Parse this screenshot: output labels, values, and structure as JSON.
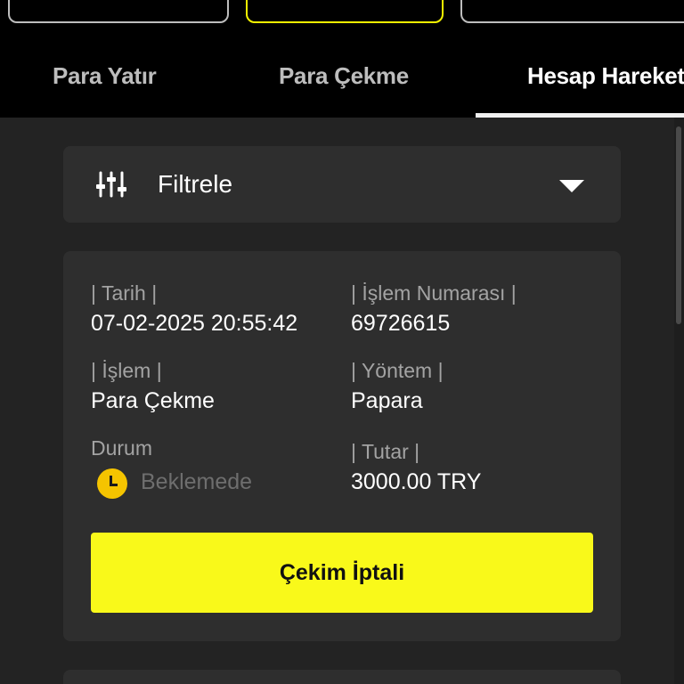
{
  "tabs": {
    "deposit": "Para Yatır",
    "withdraw": "Para Çekme",
    "history": "Hesap Hareketleri"
  },
  "filter": {
    "label": "Filtrele",
    "icon": "sliders-icon",
    "chevron": "chevron-down-icon"
  },
  "transaction": {
    "date_label": "| Tarih |",
    "date_value": "07-02-2025 20:55:42",
    "number_label": "| İşlem Numarası |",
    "number_value": "69726615",
    "type_label": "| İşlem |",
    "type_value": "Para Çekme",
    "method_label": "| Yöntem |",
    "method_value": "Papara",
    "status_label": "Durum",
    "status_value": "Beklemede",
    "amount_label": "| Tutar |",
    "amount_value": "3000.00 TRY",
    "cancel_label": "Çekim İptali"
  },
  "colors": {
    "accent": "#f9f91a",
    "background": "#232323",
    "card": "#2e2e2e",
    "header": "#000000",
    "pending": "#f5c400"
  }
}
